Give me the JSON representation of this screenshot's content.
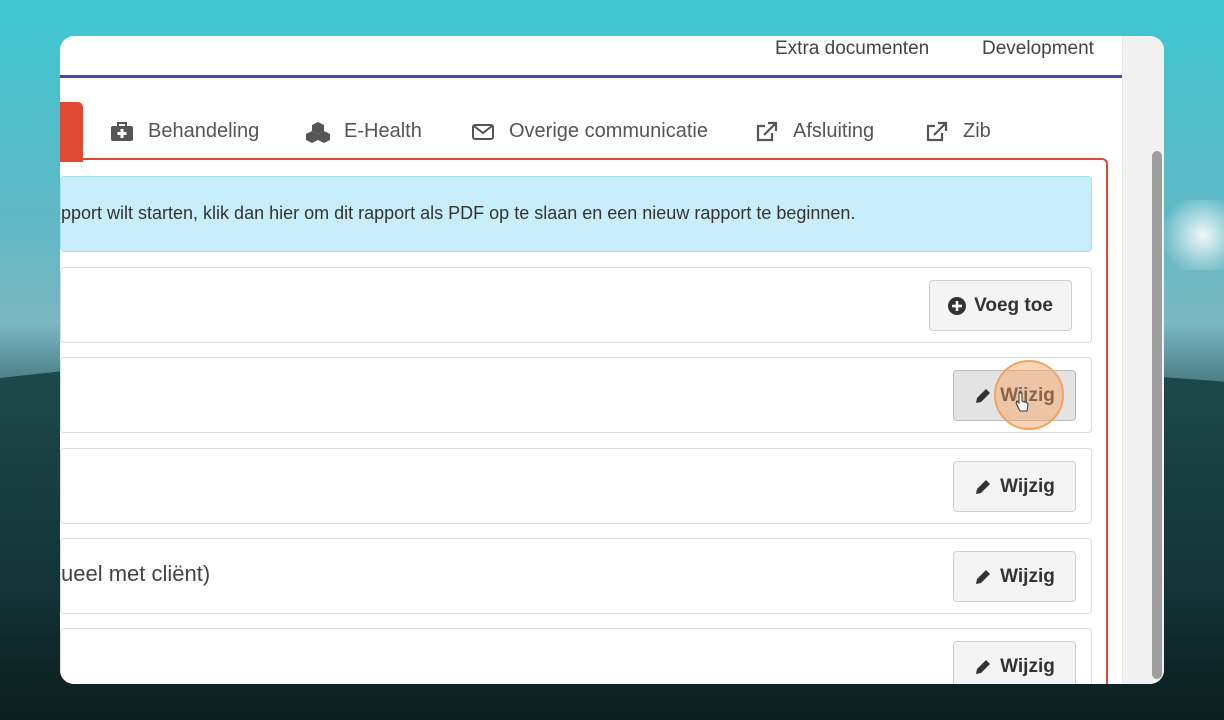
{
  "topnav": {
    "links": [
      "Extra documenten",
      "Development"
    ]
  },
  "tabs": [
    {
      "label": "Behandeling",
      "icon": "medical-kit-icon"
    },
    {
      "label": "E-Health",
      "icon": "cubes-icon"
    },
    {
      "label": "Overige communicatie",
      "icon": "envelope-icon"
    },
    {
      "label": "Afsluiting",
      "icon": "external-link-icon"
    },
    {
      "label": "Zib",
      "icon": "external-link-icon"
    }
  ],
  "alert": {
    "text": "pport wilt starten, klik dan hier om dit rapport als PDF op te slaan en een nieuw rapport te beginnen."
  },
  "rows": [
    {
      "text": "",
      "button": {
        "label": "Voeg toe",
        "icon": "plus-circle-icon"
      }
    },
    {
      "text": "",
      "button": {
        "label": "Wijzig",
        "icon": "pencil-icon"
      }
    },
    {
      "text": "",
      "button": {
        "label": "Wijzig",
        "icon": "pencil-icon"
      }
    },
    {
      "text": "ueel met cliënt)",
      "button": {
        "label": "Wijzig",
        "icon": "pencil-icon"
      }
    },
    {
      "text": "",
      "button": {
        "label": "Wijzig",
        "icon": "pencil-icon"
      }
    }
  ],
  "colors": {
    "accent": "#e04a35",
    "nav_border": "#3b4fa3",
    "alert_bg": "#c9eefb",
    "click_ring": "#f2a263"
  }
}
